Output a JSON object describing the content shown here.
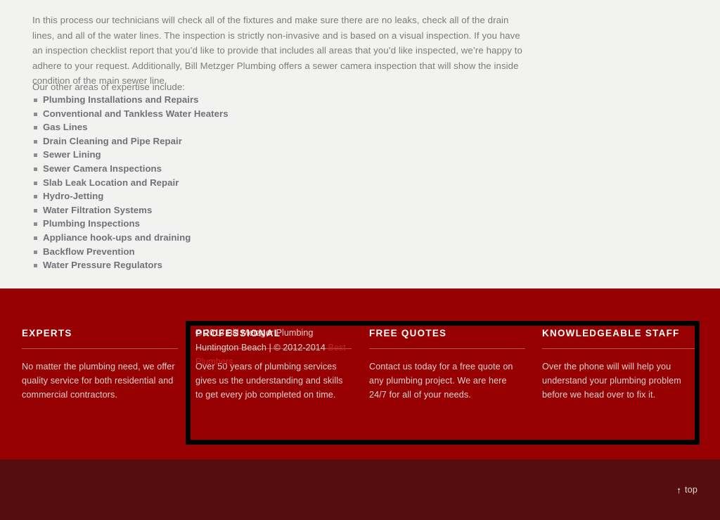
{
  "content": {
    "intro_paragraph": "In this process our technicians will check all of the fixtures and make sure there are no leaks, check all of the drain lines, and all of the water lines. The inspection is strictly non-invasive and is based on a visual inspection. If you have an inspection checklist report that you’d like to provide that includes all areas that you’d like inspected, we’re happy to adhere to your request.  Additionally, Bill Metzger Plumbing offers a sewer camera inspection that will show the inside condition of the main sewer line.",
    "expertise_lead": "Our other areas of expertise include:",
    "expertise_items": [
      "Plumbing Installations and Repairs",
      "Conventional and Tankless Water Heaters",
      "Gas Lines",
      "Drain Cleaning and Pipe Repair",
      "Sewer Lining",
      "Sewer Camera Inspections",
      "Slab Leak Location and Repair",
      "Hydro-Jetting",
      "Water Filtration Systems",
      "Plumbing Inspections",
      "Appliance hook-ups and draining",
      "Backflow Prevention",
      "Water Pressure Regulators"
    ]
  },
  "footer": {
    "background_color": "#960000",
    "columns": [
      {
        "title": "EXPERTS",
        "body": "No matter the plumbing need, we offer quality service for both residential and commercial contractors."
      },
      {
        "title": "PROFESSIONAL",
        "body": "Over 50 years of plumbing services gives us the understanding and skills to get every job completed on time."
      },
      {
        "title": "FREE QUOTES",
        "body": "Contact us today for a free quote on any plumbing project. We are here 24/7 for all of your needs."
      },
      {
        "title": "KNOWLEDGEABLE STAFF",
        "body": "Over the phone will will help you understand your plumbing problem before we head over to fix it."
      }
    ],
    "copyright": {
      "text": "© 2013 Bill Metzger Plumbing Huntington Beach | © 2012-2014 ",
      "link_label": "Best Plumbers",
      "link_color": "#c72525"
    },
    "highlight_border_color": "#000000"
  },
  "bottom_bar": {
    "background_color": "#560d0d",
    "back_to_top_label": "top",
    "back_to_top_icon": "arrow-up-icon"
  }
}
